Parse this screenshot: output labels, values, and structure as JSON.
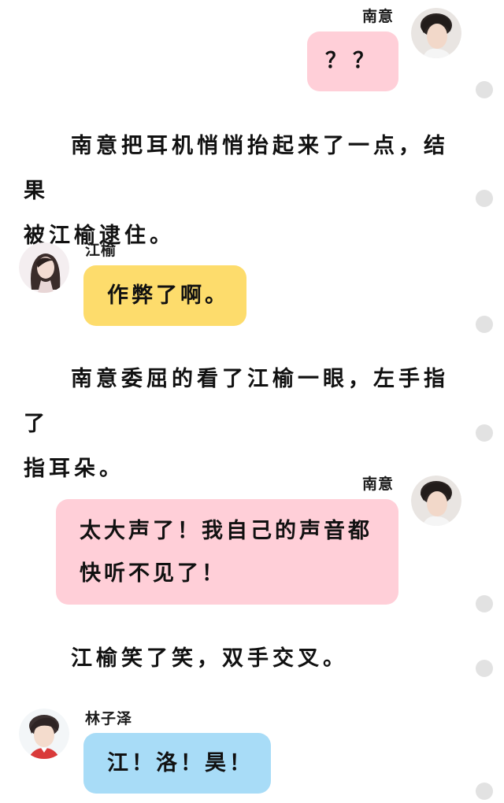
{
  "colors": {
    "nanyi_bubble": "#ffcfd8",
    "jiangyu_bubble": "#fddc6c",
    "linzize_bubble": "#a8dcf7",
    "scroll_dot": "#e2e2e2"
  },
  "messages": {
    "m1": {
      "speaker": "南意",
      "text": "？？",
      "avatar_icon": "avatar-boy-dark-hair-icon"
    },
    "m2": {
      "speaker": "江榆",
      "text": "作弊了啊。",
      "avatar_icon": "avatar-girl-long-hair-icon"
    },
    "m3": {
      "speaker": "南意",
      "line1": "太大声了！我自己的声音都",
      "line2": "快听不见了！",
      "avatar_icon": "avatar-boy-dark-hair-icon"
    },
    "m4": {
      "speaker": "林子泽",
      "text": "江！洛！昊！",
      "avatar_icon": "avatar-boy-red-shirt-icon"
    }
  },
  "narration": {
    "n1": {
      "line1": "南意把耳机悄悄抬起来了一点，结果",
      "line2": "被江榆逮住。"
    },
    "n2": {
      "line1": "南意委屈的看了江榆一眼，左手指了",
      "line2": "指耳朵。"
    },
    "n3": {
      "line1": "江榆笑了笑，双手交叉。"
    }
  }
}
